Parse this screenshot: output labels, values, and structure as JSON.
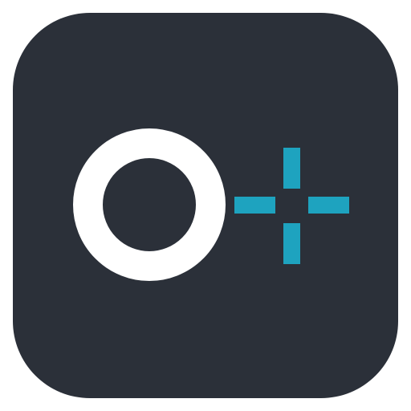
{
  "icon": {
    "name": "circle-plus-app-icon",
    "colors": {
      "background": "#2b3039",
      "ring": "#ffffff",
      "accent": "#1ea3bf"
    },
    "parts": [
      "circle-ring-icon",
      "crosshair-plus-icon"
    ]
  }
}
